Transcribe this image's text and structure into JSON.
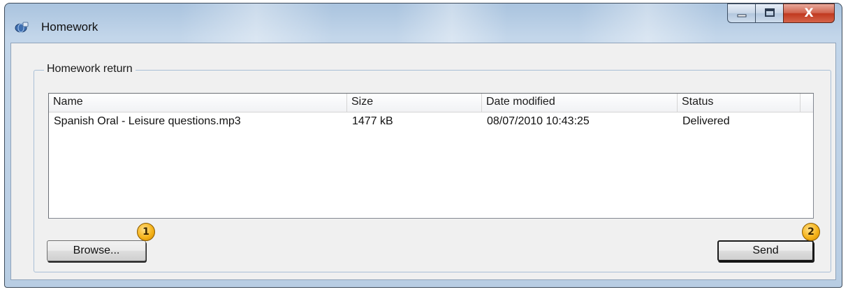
{
  "window": {
    "title": "Homework",
    "icon": "globe-app-icon",
    "caption": {
      "minimize_icon": "minimize-icon",
      "maximize_icon": "maximize-icon",
      "close_symbol": "X"
    }
  },
  "group": {
    "label": "Homework return"
  },
  "list": {
    "columns": [
      "Name",
      "Size",
      "Date modified",
      "Status",
      ""
    ],
    "rows": [
      {
        "name": "Spanish Oral - Leisure questions.mp3",
        "size": "1477 kB",
        "date_modified": "08/07/2010 10:43:25",
        "status": "Delivered"
      }
    ]
  },
  "buttons": {
    "browse": "Browse...",
    "send": "Send"
  },
  "markers": {
    "browse": "1",
    "send": "2"
  },
  "colors": {
    "marker": "#f5b31a",
    "close": "#c0391f",
    "frame": "#b8cde3"
  }
}
